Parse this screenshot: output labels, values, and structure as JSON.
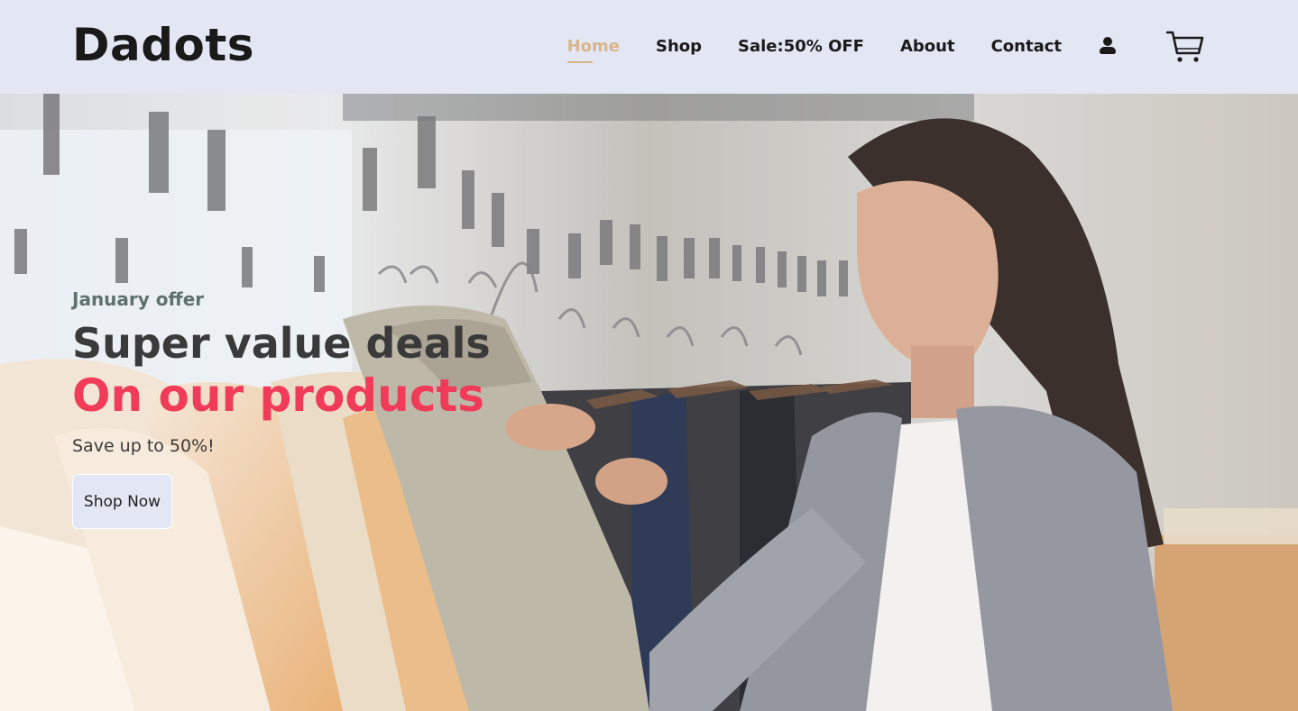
{
  "header": {
    "logo": "Dadots",
    "nav": [
      {
        "label": "Home",
        "active": true
      },
      {
        "label": "Shop",
        "active": false
      },
      {
        "label": "Sale:50% OFF",
        "active": false
      },
      {
        "label": "About",
        "active": false
      },
      {
        "label": "Contact",
        "active": false
      }
    ],
    "icons": [
      "user-icon",
      "cart-icon"
    ]
  },
  "hero": {
    "offer": "January offer",
    "headline": "Super value deals",
    "headline_accent": "On our products",
    "subtext": "Save up to 50%!",
    "button_label": "Shop Now"
  },
  "colors": {
    "header_bg": "#e3e6f3",
    "active_nav": "#d8b68c",
    "accent": "#f03c58",
    "text_dark": "#1a1a1a"
  }
}
